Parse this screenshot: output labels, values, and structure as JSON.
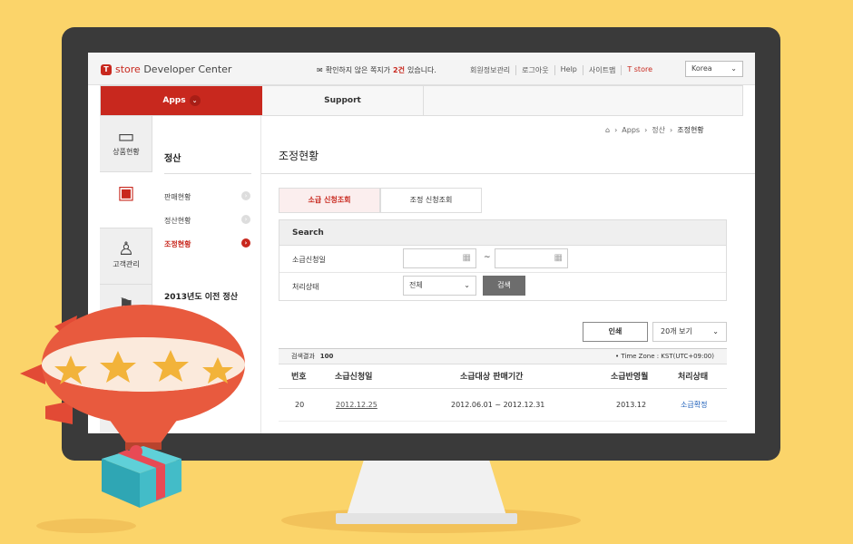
{
  "header": {
    "logo_text_brand": "store",
    "logo_text_rest": "Developer Center",
    "notice_prefix": "확인하지 않은 쪽지가",
    "notice_count": "2건",
    "notice_suffix": "있습니다.",
    "links": [
      "회원정보관리",
      "로그아웃",
      "Help",
      "사이트맵",
      "T store"
    ],
    "language": "Korea"
  },
  "nav": {
    "apps": "Apps",
    "support": "Support"
  },
  "rail": [
    {
      "label": "상품현황",
      "icon": "product-status-icon"
    },
    {
      "label": "",
      "icon": "settlement-icon"
    },
    {
      "label": "고객관리",
      "icon": "customer-icon"
    },
    {
      "label": "",
      "icon": "flag-icon"
    }
  ],
  "submenu": {
    "title": "정산",
    "items": [
      "판매현황",
      "정산현황",
      "조정현황"
    ],
    "title2": "2013년도 이전 정산"
  },
  "breadcrumb": [
    "Apps",
    "정산",
    "조정현황"
  ],
  "page_title": "조정현황",
  "tabs": [
    "소급 신청조회",
    "조정 신청조회"
  ],
  "search": {
    "heading": "Search",
    "date_label": "소급신청일",
    "tilde": "~",
    "status_label": "처리상태",
    "status_value": "전체",
    "button": "검색"
  },
  "actions": {
    "print": "인쇄",
    "per_page": "20개 보기"
  },
  "results": {
    "count_label": "검색결과",
    "count": "100",
    "timezone": "• Time Zone : KST(UTC+09:00)",
    "columns": [
      "번호",
      "소급신청일",
      "소급대상 판매기간",
      "소급반영월",
      "처리상태"
    ],
    "rows": [
      {
        "no": "20",
        "date": "2012.12.25",
        "period": "2012.06.01 ~ 2012.12.31",
        "month": "2013.12",
        "status": "소급확정"
      }
    ]
  },
  "colors": {
    "accent": "#c8281e",
    "background": "#fbd46a",
    "link": "#1d5fb9"
  }
}
